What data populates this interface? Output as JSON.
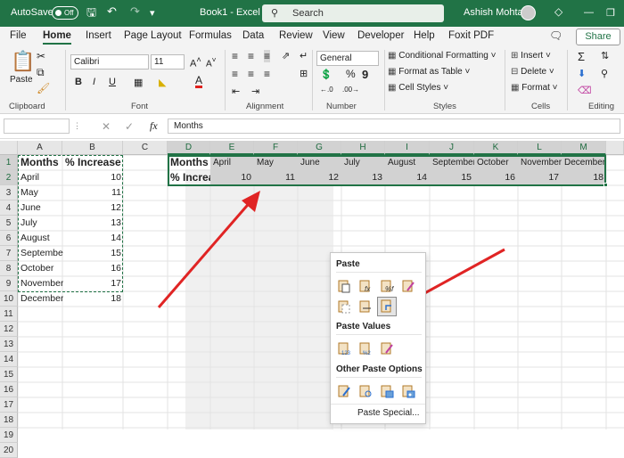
{
  "titlebar": {
    "autosave": "AutoSave",
    "toggle": "Off",
    "doc": "Book1 - Excel",
    "search": "Search",
    "user": "Ashish Mohta"
  },
  "tabs": [
    "File",
    "Home",
    "Insert",
    "Page Layout",
    "Formulas",
    "Data",
    "Review",
    "View",
    "Developer",
    "Help",
    "Foxit PDF"
  ],
  "share": "Share",
  "ribbon": {
    "clipboard": {
      "paste": "Paste",
      "label": "Clipboard"
    },
    "font": {
      "name": "Calibri",
      "size": "11",
      "label": "Font"
    },
    "alignment": {
      "label": "Alignment"
    },
    "number": {
      "format": "General",
      "label": "Number"
    },
    "styles": {
      "cond": "Conditional Formatting",
      "table": "Format as Table",
      "cell": "Cell Styles",
      "label": "Styles"
    },
    "cells": {
      "insert": "Insert",
      "delete": "Delete",
      "format": "Format",
      "label": "Cells"
    },
    "editing": {
      "label": "Editing"
    }
  },
  "formula": {
    "fx": "fx",
    "value": "Months"
  },
  "columns": [
    "A",
    "B",
    "C",
    "D",
    "E",
    "F",
    "G",
    "H",
    "I",
    "J",
    "K",
    "L",
    "M"
  ],
  "rows": [
    "1",
    "2",
    "3",
    "4",
    "5",
    "6",
    "7",
    "8",
    "9",
    "10",
    "11",
    "12",
    "13",
    "14",
    "15",
    "16",
    "17",
    "18",
    "19",
    "20"
  ],
  "source": {
    "h1": "Months",
    "h2": "% Increase",
    "months": [
      "April",
      "May",
      "June",
      "July",
      "August",
      "September",
      "October",
      "November",
      "December"
    ],
    "values": [
      "10",
      "11",
      "12",
      "13",
      "14",
      "15",
      "16",
      "17",
      "18"
    ]
  },
  "transposed": {
    "h1": "Months",
    "h2": "% Increa"
  },
  "paste_menu": {
    "paste": "Paste",
    "paste_values": "Paste Values",
    "other": "Other Paste Options",
    "special": "Paste Special..."
  }
}
